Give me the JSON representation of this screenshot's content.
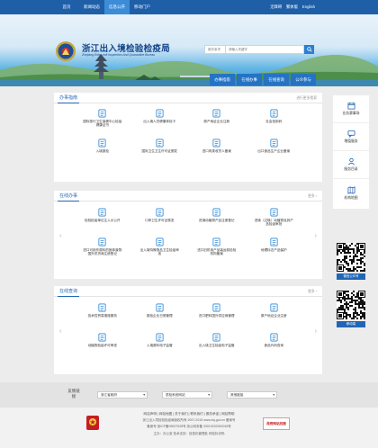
{
  "topnav": {
    "items": [
      {
        "label": "首页",
        "active": false
      },
      {
        "label": "新闻动态",
        "active": false
      },
      {
        "label": "信息公开",
        "active": true
      },
      {
        "label": "移动门户",
        "active": false
      }
    ],
    "right": [
      "无障碍",
      "繁体版",
      "English"
    ]
  },
  "header": {
    "title": "浙江出入境检验检疫局",
    "subtitle": "Zhejiang Entry-exit Inspection And Quarantine Bureau"
  },
  "search": {
    "scope": "服务事项",
    "placeholder": "请输入关键字"
  },
  "quick_buttons": [
    "办事指南",
    "在线办事",
    "在线查询",
    "公众参与"
  ],
  "panels": [
    {
      "title": "办事指南",
      "more": "进行更多搜索",
      "items": [
        {
          "label": "国际旅行卫生保健中心检疫健康证书",
          "icon": "clipboard-icon"
        },
        {
          "label": "出入境人员健康体检卡",
          "icon": "health-card-icon"
        },
        {
          "label": "原产地证企业注册",
          "icon": "certificate-icon"
        },
        {
          "label": "社会信用码",
          "icon": "badge-icon"
        },
        {
          "label": "入境报检",
          "icon": "inspection-icon"
        },
        {
          "label": "国际卫生卫生许可证颁发",
          "icon": "permit-icon"
        },
        {
          "label": "进口肉类收货人备案",
          "icon": "meat-icon"
        },
        {
          "label": "出口食品生产企业备案",
          "icon": "factory-icon"
        }
      ]
    },
    {
      "title": "在线办事",
      "more": "更多",
      "items": [
        {
          "label": "检验检疫单位注入示公开",
          "icon": "clipboard-icon"
        },
        {
          "label": "口岸卫生许可证核发",
          "icon": "permit-icon"
        },
        {
          "label": "进境动植物产品注册登记",
          "icon": "plant-icon"
        },
        {
          "label": "进境（过境）动植物及其产品检疫审批",
          "icon": "document-icon"
        },
        {
          "label": "进口可用作原料的固体废物国外供货商注册登记",
          "icon": "recycle-icon"
        },
        {
          "label": "出入境特殊物品卫生检疫审批",
          "icon": "medical-icon"
        },
        {
          "label": "进口旧机电产品装运前检验机构备案",
          "icon": "machine-icon"
        },
        {
          "label": "地理标志产品保护",
          "icon": "location-icon"
        }
      ]
    },
    {
      "title": "在线查询",
      "more": "更多",
      "items": [
        {
          "label": "技术性贸易措施服务",
          "icon": "trade-icon"
        },
        {
          "label": "报检企业日常管理",
          "icon": "manage-icon"
        },
        {
          "label": "进口肥料国外供应商管理",
          "icon": "supplier-icon"
        },
        {
          "label": "原产地证企业注册",
          "icon": "certificate-icon"
        },
        {
          "label": "动植物检疫许可审查",
          "icon": "animal-icon"
        },
        {
          "label": "入境原料电子监管",
          "icon": "monitor-icon"
        },
        {
          "label": "出入境卫生检疫电子监管",
          "icon": "shield-icon"
        },
        {
          "label": "食品代码查询",
          "icon": "search-icon"
        }
      ]
    }
  ],
  "sidebar": [
    {
      "label": "业务赛事场",
      "icon": "calendar-icon"
    },
    {
      "label": "增值服务",
      "icon": "chat-icon"
    },
    {
      "label": "服务目录",
      "icon": "person-icon"
    },
    {
      "label": "机构地图",
      "icon": "map-icon"
    }
  ],
  "qr": [
    {
      "label": "微信公众号"
    },
    {
      "label": "移动端"
    }
  ],
  "footer_links": {
    "label": "友情链接",
    "selects": [
      "浙江省政府",
      "质检系统网站",
      "其他链接"
    ]
  },
  "footer": {
    "links": "网站声明 | 网站地图 | 关于我们 | 联系我们 | 服务承诺 | 网站帮助",
    "line1": "浙江出入境检验检疫局版权所有 2007-2015 www.ziq.gov.cn 备案号",
    "line2": "备案号 浙ICP备05007528号 浙公网安备 33010202000018号",
    "line3": "主办：办公室 技术支持：信息化管理处 网站标识码",
    "badge_right": "政府网站找错"
  }
}
